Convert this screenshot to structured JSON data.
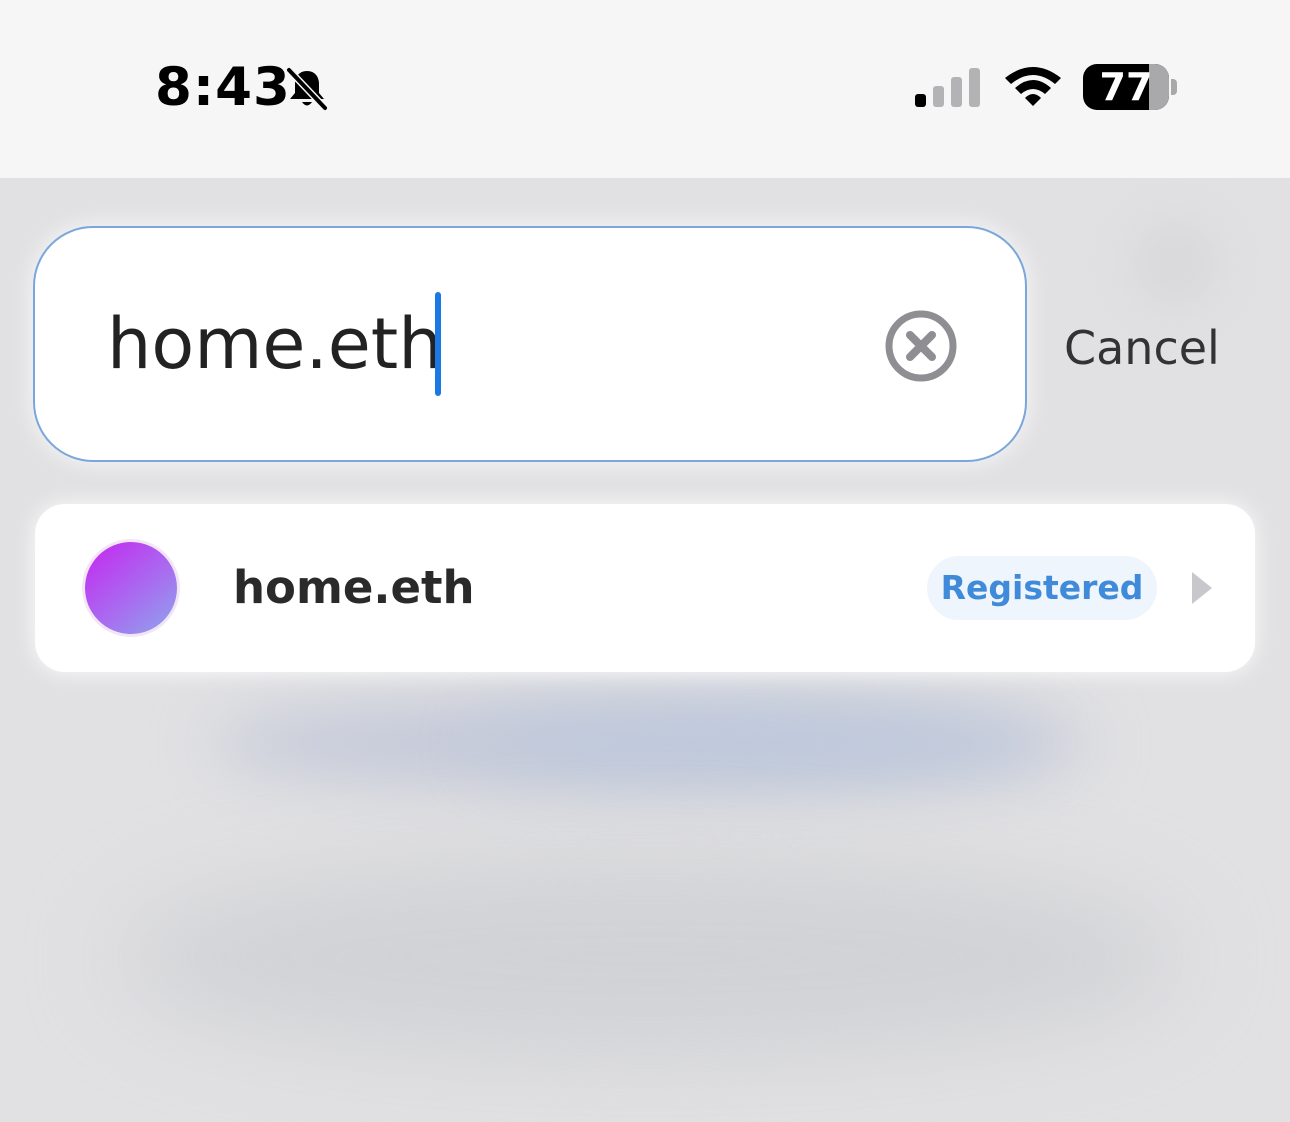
{
  "status_bar": {
    "time": "8:43",
    "battery_percent": "77",
    "battery_level": 0.77,
    "icons": [
      "bell-slash-icon",
      "signal-icon",
      "wifi-icon",
      "battery-icon"
    ]
  },
  "search": {
    "value": "home.eth",
    "clear_icon": "clear-circle-icon",
    "cancel_label": "Cancel"
  },
  "results": [
    {
      "name": "home.eth",
      "badge": "Registered",
      "icon": "chevron-right-icon"
    }
  ],
  "colors": {
    "accent": "#1c78e3",
    "badge_text": "#3f8ad9",
    "badge_bg": "#eef5fd",
    "avatar_start": "#c625ef",
    "avatar_end": "#8ea6ec"
  }
}
